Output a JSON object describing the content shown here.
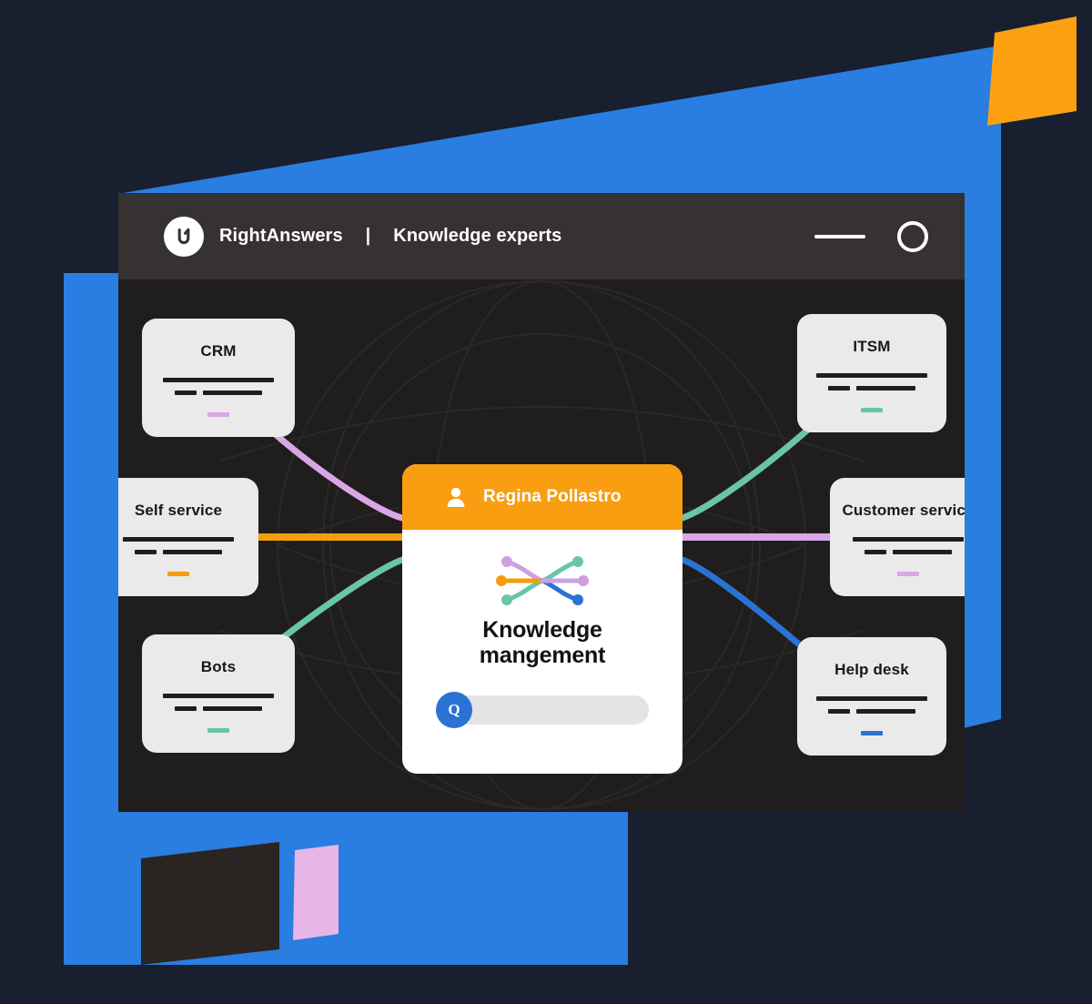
{
  "window": {
    "brand_name": "RightAnswers",
    "separator": "|",
    "subtitle": "Knowledge experts",
    "logo_letter": "U",
    "controls": {
      "minimize_label": "Minimize",
      "maximize_label": "Maximize"
    }
  },
  "center_card": {
    "user_name": "Regina Pollastro",
    "title_line1": "Knowledge",
    "title_line2": "mangement",
    "search_button_label": "Q",
    "search_placeholder": ""
  },
  "nodes": [
    {
      "id": "crm",
      "label": "CRM",
      "accent": "#d9a6e8"
    },
    {
      "id": "self-service",
      "label": "Self service",
      "accent": "#f59e0b"
    },
    {
      "id": "bots",
      "label": "Bots",
      "accent": "#6ac5a8"
    },
    {
      "id": "itsm",
      "label": "ITSM",
      "accent": "#6ac5a8"
    },
    {
      "id": "customer-service",
      "label": "Customer service",
      "accent": "#d9a6e8"
    },
    {
      "id": "help-desk",
      "label": "Help desk",
      "accent": "#2a72d4"
    }
  ],
  "connectors": [
    {
      "from": "crm",
      "color": "#d9a6e8"
    },
    {
      "from": "self-service",
      "color": "#f59e0b"
    },
    {
      "from": "bots",
      "color": "#6ac5a8"
    },
    {
      "from": "itsm",
      "color": "#6ac5a8"
    },
    {
      "from": "customer-service",
      "color": "#d9a6e8"
    },
    {
      "from": "help-desk",
      "color": "#2a72d4"
    }
  ],
  "theme": {
    "page_background": "#181f2e",
    "accent_blue": "#2a7de1",
    "accent_orange": "#fba111",
    "accent_pink": "#e8b5e8",
    "titlebar": "#363231",
    "canvas": "#201d1d",
    "card_surface": "#eaeaea",
    "center_header": "#f99d11"
  }
}
